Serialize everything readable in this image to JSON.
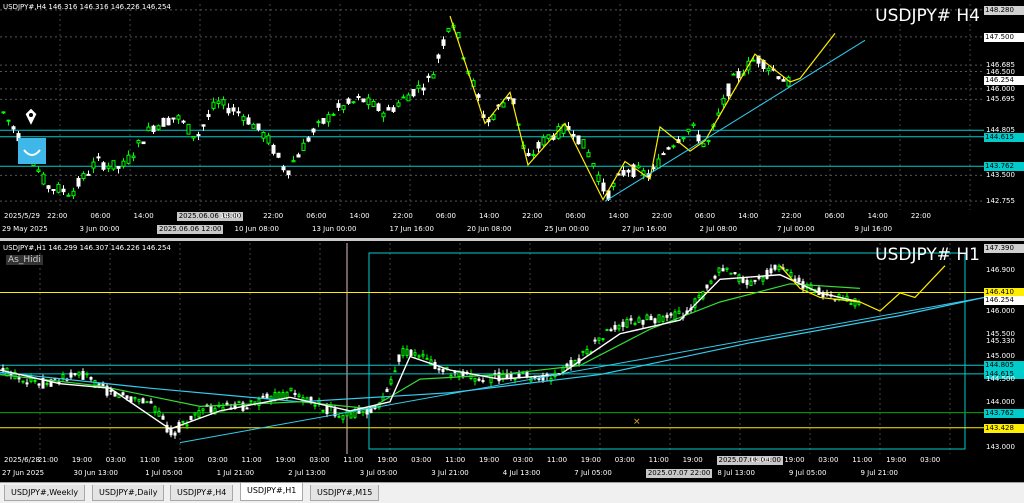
{
  "top": {
    "header": "USDJPY#,H4  146.316 146.316 146.226 146.254",
    "title": "USDJPY# H4",
    "price_ticks": [
      "148.280",
      "147.500",
      "146.685",
      "146.500",
      "146.254",
      "146.000",
      "145.695",
      "144.805",
      "144.615",
      "143.762",
      "143.500",
      "142.755"
    ],
    "time_labels": [
      "2025/5/29",
      "22:00",
      "06:00",
      "14:00",
      "2025.06.06 18:00",
      "14:00",
      "22:00",
      "06:00",
      "14:00",
      "22:00",
      "06:00",
      "14:00",
      "22:00",
      "06:00",
      "14:00",
      "22:00",
      "06:00",
      "14:00",
      "22:00",
      "06:00",
      "14:00",
      "22:00"
    ],
    "date_labels": [
      "29 May 2025",
      "3 Jun 00:00",
      "2025.06.06 12:00",
      "10 Jun 08:00",
      "13 Jun 00:00",
      "17 Jun 16:00",
      "20 Jun 08:00",
      "25 Jun 00:00",
      "27 Jun 16:00",
      "2 Jul 08:00",
      "7 Jul 00:00",
      "9 Jul 16:00"
    ]
  },
  "bottom": {
    "header": "USDJPY#,H1  146.299 146.307 146.226 146.254",
    "legend": "As_Hidi",
    "title": "USDJPY# H1",
    "price_ticks": [
      "147.390",
      "146.900",
      "146.410",
      "146.254",
      "146.000",
      "145.500",
      "145.330",
      "145.000",
      "144.805",
      "144.615",
      "144.500",
      "144.000",
      "143.762",
      "143.428",
      "143.000"
    ],
    "time_labels": [
      "2025/6/28",
      "21:00",
      "19:00",
      "03:00",
      "11:00",
      "19:00",
      "03:00",
      "11:00",
      "19:00",
      "03:00",
      "11:00",
      "19:00",
      "03:00",
      "11:00",
      "19:00",
      "03:00",
      "11:00",
      "19:00",
      "03:00",
      "11:00",
      "19:00",
      "2025.07.08 04:00",
      "11:00",
      "19:00",
      "03:00",
      "11:00",
      "19:00",
      "03:00"
    ],
    "date_labels": [
      "27 Jun 2025",
      "30 Jun 13:00",
      "1 Jul 05:00",
      "1 Jul 21:00",
      "2 Jul 13:00",
      "3 Jul 05:00",
      "3 Jul 21:00",
      "4 Jul 13:00",
      "7 Jul 05:00",
      "2025.07.07 22:00",
      "8 Jul 13:00",
      "9 Jul 05:00",
      "9 Jul 21:00"
    ]
  },
  "tabs": [
    "USDJPY#,Weekly",
    "USDJPY#,Daily",
    "USDJPY#,H4",
    "USDJPY#,H1",
    "USDJPY#,M15"
  ],
  "active_tab": "USDJPY#,H1",
  "colors": {
    "up": "#00ff00",
    "down": "#ffffff",
    "ma_fast": "#ffffff",
    "ma_mid": "#33dd33",
    "ma_slow": "#33ccee",
    "trend": "#33ccee",
    "zigzag": "#ffee00",
    "hline_cyan": "#00cccc",
    "hline_yellow": "#ffee00"
  }
}
